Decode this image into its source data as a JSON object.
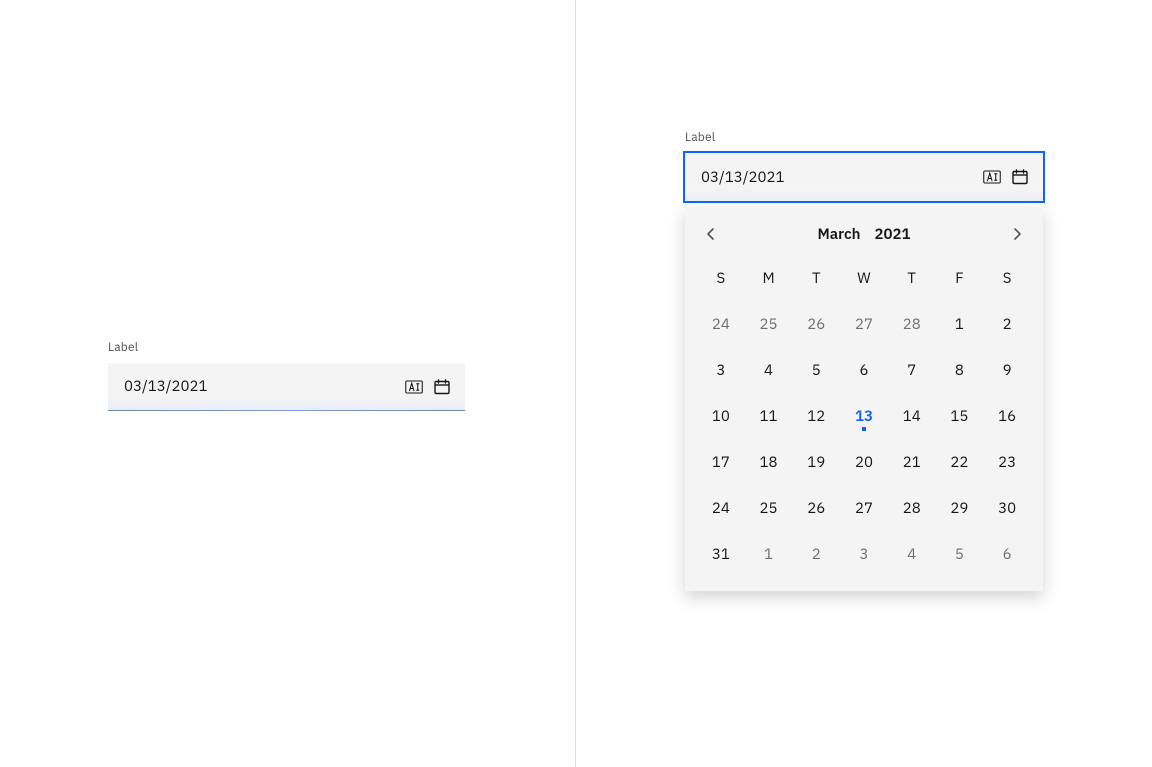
{
  "left": {
    "label": "Label",
    "value": "03/13/2021"
  },
  "right": {
    "label": "Label",
    "value": "03/13/2021"
  },
  "calendar": {
    "month": "March",
    "year": "2021",
    "weekdays": [
      "S",
      "M",
      "T",
      "W",
      "T",
      "F",
      "S"
    ],
    "selected_day": 13,
    "days": [
      {
        "n": 24,
        "other": true
      },
      {
        "n": 25,
        "other": true
      },
      {
        "n": 26,
        "other": true
      },
      {
        "n": 27,
        "other": true
      },
      {
        "n": 28,
        "other": true
      },
      {
        "n": 1
      },
      {
        "n": 2
      },
      {
        "n": 3
      },
      {
        "n": 4
      },
      {
        "n": 5
      },
      {
        "n": 6
      },
      {
        "n": 7
      },
      {
        "n": 8
      },
      {
        "n": 9
      },
      {
        "n": 10
      },
      {
        "n": 11
      },
      {
        "n": 12
      },
      {
        "n": 13,
        "selected": true
      },
      {
        "n": 14
      },
      {
        "n": 15
      },
      {
        "n": 16
      },
      {
        "n": 17
      },
      {
        "n": 18
      },
      {
        "n": 19
      },
      {
        "n": 20
      },
      {
        "n": 21
      },
      {
        "n": 22
      },
      {
        "n": 23
      },
      {
        "n": 24
      },
      {
        "n": 25
      },
      {
        "n": 26
      },
      {
        "n": 27
      },
      {
        "n": 28
      },
      {
        "n": 29
      },
      {
        "n": 30
      },
      {
        "n": 31
      },
      {
        "n": 1,
        "other": true
      },
      {
        "n": 2,
        "other": true
      },
      {
        "n": 3,
        "other": true
      },
      {
        "n": 4,
        "other": true
      },
      {
        "n": 5,
        "other": true
      },
      {
        "n": 6,
        "other": true
      }
    ]
  }
}
